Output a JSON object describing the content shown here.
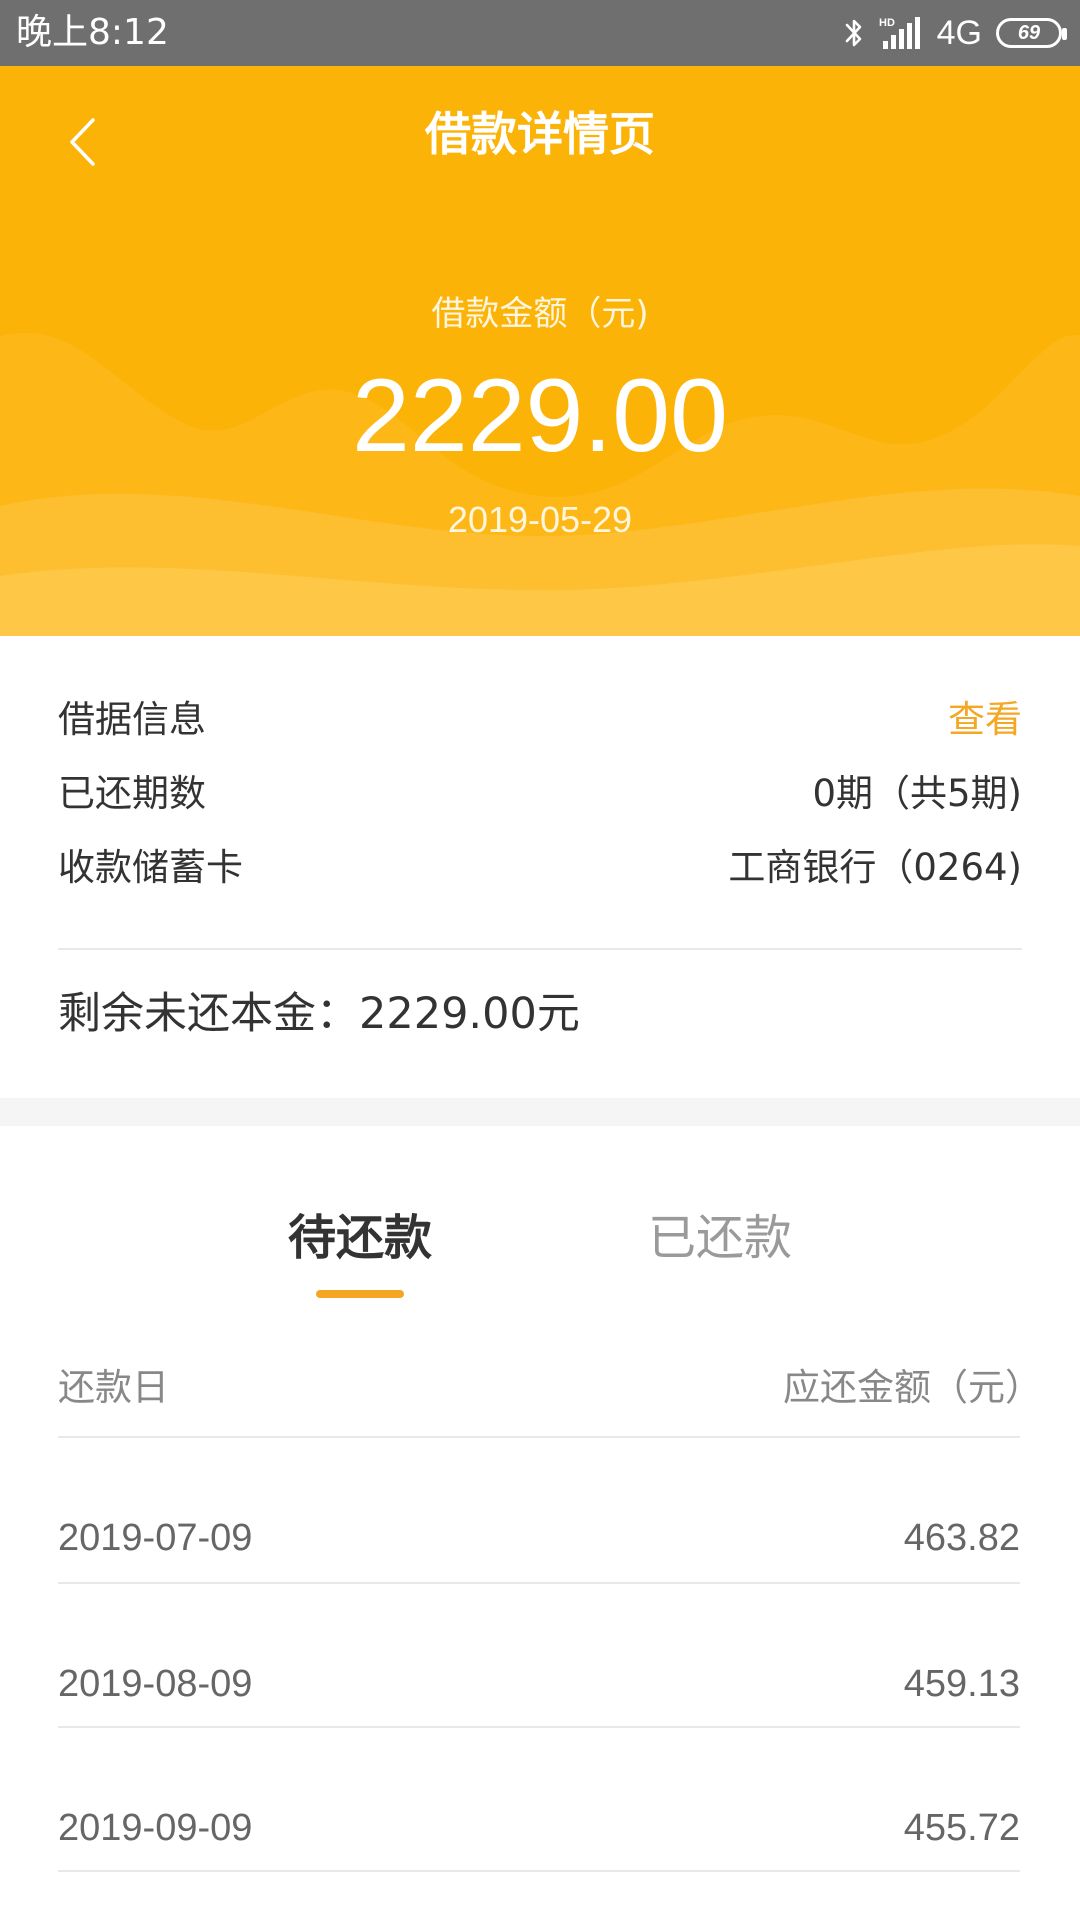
{
  "status_bar": {
    "time": "晚上8:12",
    "network": "4G",
    "battery": "69",
    "icons": [
      "bluetooth-icon",
      "hd-signal-icon",
      "battery-icon"
    ]
  },
  "header": {
    "title": "借款详情页",
    "back_icon": "chevron-left-icon",
    "background_color": "#fcb308"
  },
  "loan": {
    "amount_label": "借款金额（元)",
    "amount": "2229.00",
    "date": "2019-05-29"
  },
  "info": {
    "rows": [
      {
        "label": "借据信息",
        "value": "查看"
      },
      {
        "label": "已还期数",
        "value": "0期（共5期)"
      },
      {
        "label": "收款储蓄卡",
        "value": "工商银行（0264)"
      }
    ],
    "remaining": "剩余未还本金：2229.00元",
    "link_color": "#f5a623"
  },
  "tabs": {
    "pending": "待还款",
    "paid": "已还款",
    "active": "待还款"
  },
  "schedule": {
    "header_date": "还款日",
    "header_amount": "应还金额（元）",
    "rows": [
      {
        "date": "2019-07-09",
        "amount": "463.82"
      },
      {
        "date": "2019-08-09",
        "amount": "459.13"
      },
      {
        "date": "2019-09-09",
        "amount": "455.72"
      }
    ]
  }
}
